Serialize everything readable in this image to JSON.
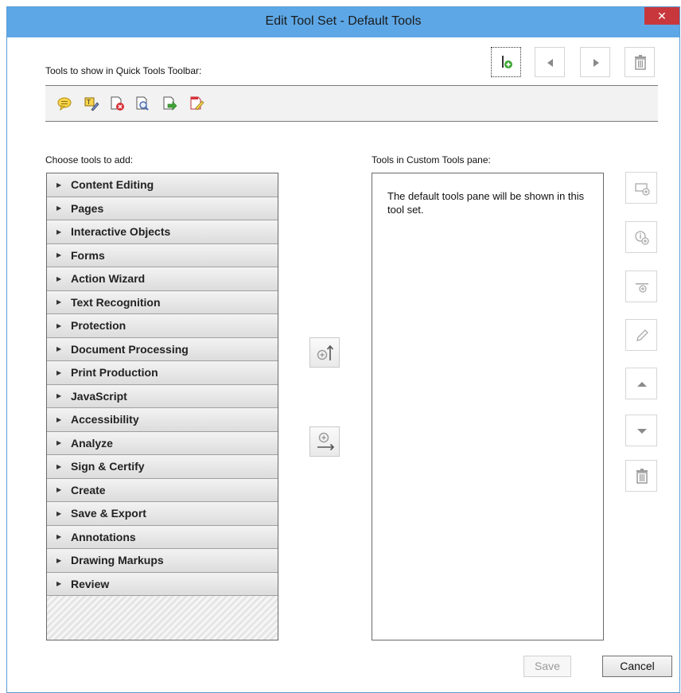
{
  "window": {
    "title": "Edit Tool Set - Default Tools",
    "close_symbol": "✕"
  },
  "toolbar_buttons": [
    {
      "name": "add-to-quick-tools-button",
      "icon": "add-tool-icon"
    },
    {
      "name": "move-left-button",
      "icon": "triangle-left-icon"
    },
    {
      "name": "move-right-button",
      "icon": "triangle-right-icon"
    },
    {
      "name": "delete-quick-tool-button",
      "icon": "trash-icon"
    }
  ],
  "quick_tools": {
    "label": "Tools to show in Quick Tools Toolbar:",
    "icons": [
      "comment-icon",
      "edit-text-icon",
      "delete-pages-icon",
      "find-icon",
      "export-icon",
      "fill-sign-icon"
    ]
  },
  "choose": {
    "label": "Choose tools to add:",
    "categories": [
      "Content Editing",
      "Pages",
      "Interactive Objects",
      "Forms",
      "Action Wizard",
      "Text Recognition",
      "Protection",
      "Document Processing",
      "Print Production",
      "JavaScript",
      "Accessibility",
      "Analyze",
      "Sign & Certify",
      "Create",
      "Save & Export",
      "Annotations",
      "Drawing Markups",
      "Review"
    ]
  },
  "custom_pane": {
    "label": "Tools in Custom Tools pane:",
    "text": "The default tools pane will be shown in this tool set."
  },
  "buttons": {
    "save": "Save",
    "cancel": "Cancel"
  },
  "colors": {
    "titlebar": "#5da7e6",
    "close": "#c8373b"
  }
}
